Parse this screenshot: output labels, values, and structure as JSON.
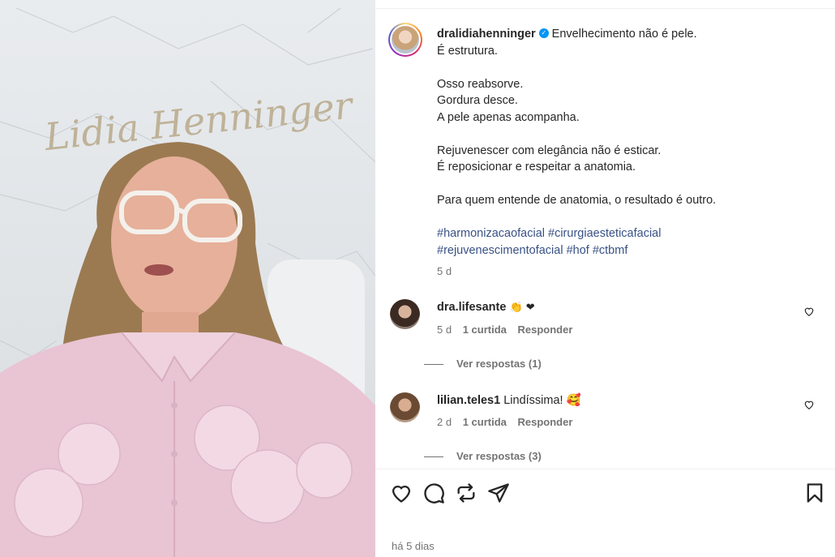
{
  "media": {
    "signature": "Lidia Henninger"
  },
  "post": {
    "username": "dralidiahenninger",
    "caption_lines": [
      "Envelhecimento não é pele.",
      "É estrutura.",
      "",
      "Osso reabsorve.",
      "Gordura desce.",
      "A pele apenas acompanha.",
      "",
      "Rejuvenescer com elegância não é esticar.",
      "É reposicionar e respeitar a anatomia.",
      "",
      "Para quem entende de anatomia, o resultado é outro.",
      ""
    ],
    "hashtags_line1": "#harmonizacaofacial #cirurgiaesteticafacial",
    "hashtags_line2": "#rejuvenescimentofacial #hof #ctbmf",
    "age": "5 d"
  },
  "comments": [
    {
      "username": "dra.lifesante",
      "text": "👏 ❤",
      "age": "5 d",
      "likes": "1 curtida",
      "reply": "Responder",
      "view_replies": "Ver respostas (1)"
    },
    {
      "username": "lilian.teles1",
      "text": "Lindíssima! 🥰",
      "age": "2 d",
      "likes": "1 curtida",
      "reply": "Responder",
      "view_replies": "Ver respostas (3)"
    }
  ],
  "footer": {
    "time": "há 5 dias"
  },
  "icons": {
    "like": "heart-icon",
    "comment": "comment-icon",
    "repost": "repost-icon",
    "share": "send-icon",
    "save": "bookmark-icon"
  },
  "colors": {
    "hashtag": "#385185",
    "verified": "#0095f6",
    "meta": "#737373"
  }
}
